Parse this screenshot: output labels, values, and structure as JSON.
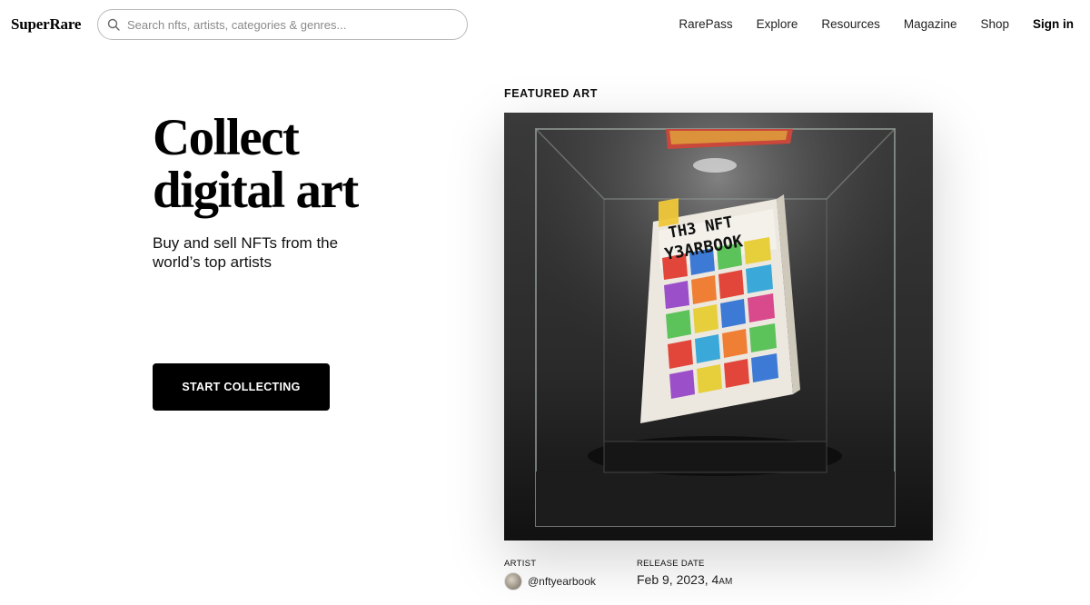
{
  "header": {
    "logo": "SuperRare",
    "search_placeholder": "Search nfts, artists, categories & genres...",
    "nav": [
      "RarePass",
      "Explore",
      "Resources",
      "Magazine",
      "Shop"
    ],
    "signin": "Sign in"
  },
  "hero": {
    "title_line1": "Collect",
    "title_line2": "digital art",
    "subtitle": "Buy and sell NFTs from the world’s top artists",
    "cta": "START COLLECTING"
  },
  "featured": {
    "label": "FEATURED ART",
    "artwork_text_1": "TH3 NFT",
    "artwork_text_2": "Y3ARBOOK",
    "artist_label": "ARTIST",
    "artist_handle": "@nftyearbook",
    "release_label": "RELEASE DATE",
    "release_date": "Feb 9, 2023, 4",
    "release_ampm": "AM"
  },
  "colors": {
    "background": "#ffffff",
    "text": "#000000",
    "button": "#000000",
    "button_text": "#ffffff"
  }
}
